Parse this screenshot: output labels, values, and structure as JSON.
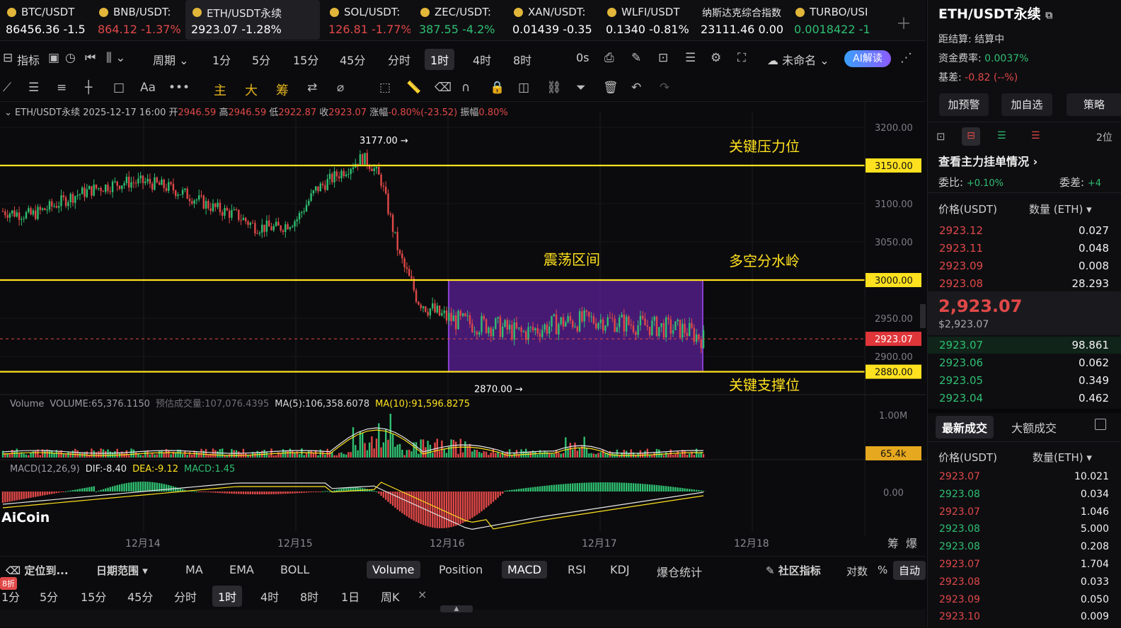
{
  "tickers": [
    {
      "name": "BTC/USDT",
      "price": "86456.36",
      "change": "-1.5",
      "pcolor": "#ffffff",
      "ccolor": "#ffffff",
      "active": false
    },
    {
      "name": "BNB/USDT:",
      "price": "864.12",
      "change": "-1.37%",
      "pcolor": "#e04848",
      "ccolor": "#e04848",
      "active": false
    },
    {
      "name": "ETH/USDT永续",
      "price": "2923.07",
      "change": "-1.28%",
      "pcolor": "#ffffff",
      "ccolor": "#ffffff",
      "active": true
    },
    {
      "name": "SOL/USDT:",
      "price": "126.81",
      "change": "-1.77%",
      "pcolor": "#e04848",
      "ccolor": "#e04848",
      "active": false
    },
    {
      "name": "ZEC/USDT:",
      "price": "387.55",
      "change": "-4.2%",
      "pcolor": "#2fbf71",
      "ccolor": "#2fbf71",
      "active": false
    },
    {
      "name": "XAN/USDT:",
      "price": "0.01439",
      "change": "-0.35",
      "pcolor": "#ffffff",
      "ccolor": "#ffffff",
      "active": false
    },
    {
      "name": "WLFI/USDT",
      "price": "0.1340",
      "change": "-0.81%",
      "pcolor": "#ffffff",
      "ccolor": "#ffffff",
      "active": false
    },
    {
      "name": "纳斯达克综合指数",
      "price": "23111.46",
      "change": "0.00",
      "pcolor": "#ffffff",
      "ccolor": "#ffffff",
      "active": false
    },
    {
      "name": "TURBO/USI",
      "price": "0.0018422",
      "change": "-1",
      "pcolor": "#2fbf71",
      "ccolor": "#2fbf71",
      "active": false
    }
  ],
  "toolbar": {
    "indicator": "指标",
    "period": "周期",
    "intervals": [
      "1分",
      "5分",
      "15分",
      "45分",
      "分时",
      "1时",
      "4时",
      "8时"
    ],
    "selected": "1时",
    "zero_s": "0s",
    "unnamed": "未命名",
    "ai": "AI解读"
  },
  "drawing_tools": {
    "main": "主",
    "big": "大",
    "chip": "筹"
  },
  "ohlc": {
    "symbol": "ETH/USDT永续",
    "datetime": "2025-12-17 16:00",
    "open_label": "开",
    "open": "2946.59",
    "high_label": "高",
    "high": "2946.59",
    "low_label": "低",
    "low": "2922.87",
    "close_label": "收",
    "close": "2923.07",
    "chg_label": "涨幅",
    "chg": "-0.80%(-23.52)",
    "amp_label": "振幅",
    "amp": "0.80%"
  },
  "chart_data": {
    "type": "candlestick",
    "price_ticks": [
      "3200.00",
      "3150.00",
      "3100.00",
      "3050.00",
      "3000.00",
      "2950.00",
      "2900.00"
    ],
    "ylim": [
      2860,
      3215
    ],
    "x_labels": [
      "12月14",
      "12月15",
      "12月16",
      "12月17",
      "12月18"
    ],
    "levels": [
      {
        "price": 3150,
        "label": "3150.00",
        "annotation": "关键压力位"
      },
      {
        "price": 3000,
        "label": "3000.00",
        "annotation": "多空分水岭"
      },
      {
        "price": 2880,
        "label": "2880.00",
        "annotation": "关键支撑位"
      }
    ],
    "current": {
      "price": 2923.07,
      "label": "2923.07"
    },
    "range_box": {
      "label": "震荡区间",
      "top": 3000,
      "bottom": 2880
    },
    "high_marker": "3177.00 →",
    "low_marker": "2870.00 →",
    "volume": {
      "title": "Volume",
      "value": "VOLUME:65,376.1150",
      "est": "预估成交量:107,076.4395",
      "ma5": "MA(5):106,358.6078",
      "ma10": "MA(10):91,596.8275",
      "tick": "1.00M",
      "last": "65.4k"
    },
    "macd": {
      "title": "MACD(12,26,9)",
      "dif": "DIF:-8.40",
      "dea": "DEA:-9.12",
      "macd": "MACD:1.45",
      "zero": "0.00"
    }
  },
  "right": {
    "title": "ETH/USDT永续",
    "settle_label": "距结算:",
    "settle": "结算中",
    "fund_label": "资金费率:",
    "fund": "0.0037%",
    "basis_label": "基差:",
    "basis": "-0.82 (--%)",
    "buttons": [
      "加预警",
      "加自选",
      "策略"
    ],
    "depth_title": "查看主力挂单情况 ›",
    "wb_label": "委比:",
    "wb": "+0.10%",
    "wc_label": "委差:",
    "wc": "+4",
    "col_price": "价格(USDT)",
    "col_qty": "数量 (ETH) ▾",
    "asks": [
      [
        "2923.12",
        "0.027"
      ],
      [
        "2923.11",
        "0.048"
      ],
      [
        "2923.09",
        "0.008"
      ],
      [
        "2923.08",
        "28.293"
      ]
    ],
    "last_price": "2,923.07",
    "last_usd": "$2,923.07",
    "bids": [
      [
        "2923.07",
        "98.861"
      ],
      [
        "2923.06",
        "0.062"
      ],
      [
        "2923.05",
        "0.349"
      ],
      [
        "2923.04",
        "0.462"
      ]
    ],
    "tab_latest": "最新成交",
    "tab_large": "大额成交",
    "col_qty2": "数量(ETH) ▾",
    "trades": [
      [
        "2923.07",
        "10.021",
        "r"
      ],
      [
        "2923.08",
        "0.034",
        "g"
      ],
      [
        "2923.07",
        "1.046",
        "r"
      ],
      [
        "2923.08",
        "5.000",
        "g"
      ],
      [
        "2923.08",
        "0.208",
        "g"
      ],
      [
        "2923.07",
        "1.704",
        "r"
      ],
      [
        "2923.08",
        "0.033",
        "r"
      ],
      [
        "2923.09",
        "0.050",
        "r"
      ],
      [
        "2923.10",
        "0.009",
        "r"
      ]
    ],
    "depth_num": "2位"
  },
  "bottom": {
    "locate": "定位到...",
    "range": "日期范围",
    "inds": [
      "MA",
      "EMA",
      "BOLL",
      "Volume",
      "Position",
      "MACD",
      "RSI",
      "KDJ",
      "爆仓统计"
    ],
    "community": "社区指标",
    "log": "对数",
    "pct": "%",
    "auto": "自动",
    "intervals": [
      "1分",
      "5分",
      "15分",
      "45分",
      "分时",
      "1时",
      "4时",
      "8时",
      "1日",
      "周K"
    ],
    "selected": "1时",
    "badge": "8折",
    "chip": "筹",
    "blast": "爆",
    "watermark": "AiCoin"
  }
}
